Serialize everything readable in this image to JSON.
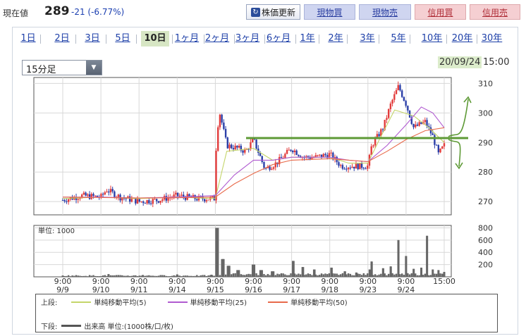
{
  "quote": {
    "label": "現在値",
    "price": "289",
    "change": "-21 (-6.77%)"
  },
  "actions": {
    "refresh": "株価更新",
    "genbutsu_buy": "現物買",
    "genbutsu_sell": "現物売",
    "shinyo_buy": "信用買",
    "shinyo_sell": "信用売"
  },
  "periods": [
    "1日",
    "2日",
    "3日",
    "5日",
    "10日",
    "1ヶ月",
    "2ヶ月",
    "3ヶ月",
    "6ヶ月",
    "1年",
    "2年",
    "3年",
    "5年",
    "10年",
    "20年",
    "30年"
  ],
  "active_period": "10日",
  "interval": {
    "selected": "15分足"
  },
  "latest": {
    "date": "20/09/24",
    "time": "15:00"
  },
  "colors": {
    "up": "#e23b3b",
    "down": "#2b3fa8",
    "ma5": "#c4d56a",
    "ma25": "#b05ad0",
    "ma50": "#e86a4a",
    "volume": "#666666",
    "annotation": "#5e9a36"
  },
  "chart_data": [
    {
      "type": "candlestick",
      "title": "",
      "y_ticks": [
        270,
        280,
        290,
        300,
        310
      ],
      "ylim": [
        265.5,
        312
      ],
      "x_tick_labels": [
        {
          "time": "9:00",
          "date": "9/9"
        },
        {
          "time": "9:00",
          "date": "9/10"
        },
        {
          "time": "9:00",
          "date": "9/11"
        },
        {
          "time": "9:00",
          "date": "9/14"
        },
        {
          "time": "9:00",
          "date": "9/15"
        },
        {
          "time": "9:00",
          "date": "9/16"
        },
        {
          "time": "9:00",
          "date": "9/17"
        },
        {
          "time": "9:00",
          "date": "9/18"
        },
        {
          "time": "9:00",
          "date": "9/23"
        },
        {
          "time": "9:00",
          "date": "9/24"
        },
        {
          "time": "15:00",
          "date": ""
        }
      ],
      "close_series": [
        {
          "x": 0.0,
          "y": 270.5
        },
        {
          "x": 0.5,
          "y": 272
        },
        {
          "x": 1.0,
          "y": 271.5
        },
        {
          "x": 1.15,
          "y": 274
        },
        {
          "x": 1.5,
          "y": 271.5
        },
        {
          "x": 2.0,
          "y": 270
        },
        {
          "x": 2.5,
          "y": 270.5
        },
        {
          "x": 3.0,
          "y": 272
        },
        {
          "x": 3.5,
          "y": 271
        },
        {
          "x": 4.0,
          "y": 271
        },
        {
          "x": 4.02,
          "y": 288
        },
        {
          "x": 4.1,
          "y": 301
        },
        {
          "x": 4.3,
          "y": 289
        },
        {
          "x": 4.6,
          "y": 288
        },
        {
          "x": 4.8,
          "y": 287
        },
        {
          "x": 5.0,
          "y": 291
        },
        {
          "x": 5.3,
          "y": 281
        },
        {
          "x": 5.6,
          "y": 283
        },
        {
          "x": 6.0,
          "y": 288
        },
        {
          "x": 6.3,
          "y": 285
        },
        {
          "x": 6.6,
          "y": 285
        },
        {
          "x": 7.0,
          "y": 286
        },
        {
          "x": 7.3,
          "y": 282
        },
        {
          "x": 7.6,
          "y": 282
        },
        {
          "x": 8.0,
          "y": 282
        },
        {
          "x": 8.1,
          "y": 289
        },
        {
          "x": 8.4,
          "y": 295
        },
        {
          "x": 8.6,
          "y": 303
        },
        {
          "x": 8.8,
          "y": 309
        },
        {
          "x": 9.0,
          "y": 303
        },
        {
          "x": 9.2,
          "y": 295
        },
        {
          "x": 9.5,
          "y": 297
        },
        {
          "x": 9.7,
          "y": 292
        },
        {
          "x": 9.85,
          "y": 286
        },
        {
          "x": 10.0,
          "y": 289
        }
      ],
      "moving_averages": [
        {
          "name": "単純移動平均(5)",
          "points": [
            [
              0,
              271
            ],
            [
              1,
              271.5
            ],
            [
              2,
              271
            ],
            [
              3,
              271.5
            ],
            [
              4,
              271
            ],
            [
              4.3,
              287
            ],
            [
              5,
              288
            ],
            [
              5.5,
              284
            ],
            [
              6,
              285
            ],
            [
              7,
              285
            ],
            [
              7.5,
              283
            ],
            [
              8,
              283
            ],
            [
              8.3,
              291
            ],
            [
              8.7,
              301
            ],
            [
              9.2,
              299
            ],
            [
              9.6,
              295
            ],
            [
              10,
              290
            ]
          ]
        },
        {
          "name": "単純移動平均(25)",
          "points": [
            [
              0,
              271.5
            ],
            [
              1,
              271.5
            ],
            [
              2,
              271.2
            ],
            [
              3,
              271.5
            ],
            [
              4,
              272
            ],
            [
              4.5,
              279
            ],
            [
              5,
              284
            ],
            [
              5.5,
              284
            ],
            [
              6,
              285
            ],
            [
              7,
              285
            ],
            [
              7.5,
              284
            ],
            [
              8,
              283.5
            ],
            [
              8.5,
              289
            ],
            [
              9,
              296
            ],
            [
              9.4,
              302
            ],
            [
              9.7,
              300
            ],
            [
              10,
              295
            ]
          ]
        },
        {
          "name": "単純移動平均(50)",
          "points": [
            [
              0,
              271.5
            ],
            [
              2,
              271.2
            ],
            [
              3,
              271.3
            ],
            [
              4,
              271.5
            ],
            [
              4.5,
              276
            ],
            [
              5,
              279.5
            ],
            [
              5.5,
              282.5
            ],
            [
              6,
              284
            ],
            [
              7,
              284.5
            ],
            [
              7.5,
              284
            ],
            [
              8,
              283.5
            ],
            [
              8.5,
              287
            ],
            [
              9,
              291
            ],
            [
              9.5,
              294
            ],
            [
              10,
              295
            ]
          ]
        }
      ],
      "annotation": {
        "type": "horizontal_line",
        "y": 291.5
      }
    },
    {
      "type": "bar",
      "unit_label": "単位: 1000",
      "y_ticks": [
        200,
        400,
        600,
        800
      ],
      "ylim": [
        0,
        840
      ],
      "spikes": [
        {
          "x": 0.0,
          "y": 20
        },
        {
          "x": 1.2,
          "y": 45
        },
        {
          "x": 2.1,
          "y": 30
        },
        {
          "x": 3.0,
          "y": 40
        },
        {
          "x": 3.9,
          "y": 35
        },
        {
          "x": 4.05,
          "y": 800
        },
        {
          "x": 4.2,
          "y": 290
        },
        {
          "x": 4.35,
          "y": 180
        },
        {
          "x": 4.6,
          "y": 110
        },
        {
          "x": 5.0,
          "y": 200
        },
        {
          "x": 5.2,
          "y": 110
        },
        {
          "x": 5.5,
          "y": 90
        },
        {
          "x": 6.05,
          "y": 260
        },
        {
          "x": 6.3,
          "y": 160
        },
        {
          "x": 6.6,
          "y": 120
        },
        {
          "x": 7.05,
          "y": 150
        },
        {
          "x": 7.4,
          "y": 90
        },
        {
          "x": 7.7,
          "y": 70
        },
        {
          "x": 8.05,
          "y": 120
        },
        {
          "x": 8.1,
          "y": 250
        },
        {
          "x": 8.4,
          "y": 140
        },
        {
          "x": 8.6,
          "y": 170
        },
        {
          "x": 8.8,
          "y": 600
        },
        {
          "x": 9.0,
          "y": 340
        },
        {
          "x": 9.2,
          "y": 130
        },
        {
          "x": 9.4,
          "y": 150
        },
        {
          "x": 9.55,
          "y": 670
        },
        {
          "x": 9.7,
          "y": 120
        },
        {
          "x": 9.85,
          "y": 110
        },
        {
          "x": 10.0,
          "y": 80
        }
      ]
    }
  ],
  "legend": {
    "upper_label": "上段:",
    "lower_label": "下段:",
    "upper_items": [
      "単純移動平均(5)",
      "単純移動平均(25)",
      "単純移動平均(50)"
    ],
    "lower_item": "出来高 単位:(1000株/口/枚)"
  }
}
